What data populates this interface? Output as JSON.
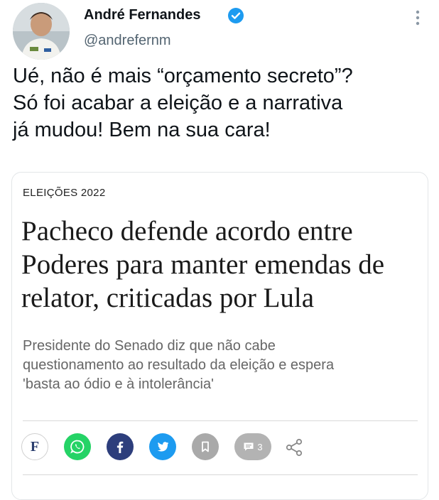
{
  "tweet": {
    "author_name": "André Fernandes",
    "handle": "@andrefernm",
    "text_lines": [
      "Ué, não é mais “orçamento secreto”?",
      "Só foi acabar a eleição e a narrativa",
      "já mudou! Bem na sua cara!"
    ]
  },
  "article": {
    "section": "ELEIÇÕES 2022",
    "headline_lines": [
      "Pacheco defende acordo entre",
      "Poderes para manter emendas de",
      "relator, criticadas por Lula"
    ],
    "subtitle_lines": [
      "Presidente do Senado diz que não cabe",
      "questionamento ao resultado da eleição e espera",
      "'basta ao ódio e à intolerância'"
    ],
    "share": {
      "font_button_label": "F",
      "comment_count": "3"
    }
  },
  "icons": [
    "verified-badge-icon",
    "more-options-icon",
    "whatsapp-icon",
    "facebook-icon",
    "twitter-icon",
    "bookmark-icon",
    "comment-icon",
    "share-icon"
  ],
  "colors": {
    "verified": "#1d9bf0",
    "whatsapp": "#25d366",
    "facebook": "#2d3e7c",
    "twitter": "#1d9bf0",
    "bookmark": "#a9a9a9",
    "comments": "#b3b3b3"
  }
}
